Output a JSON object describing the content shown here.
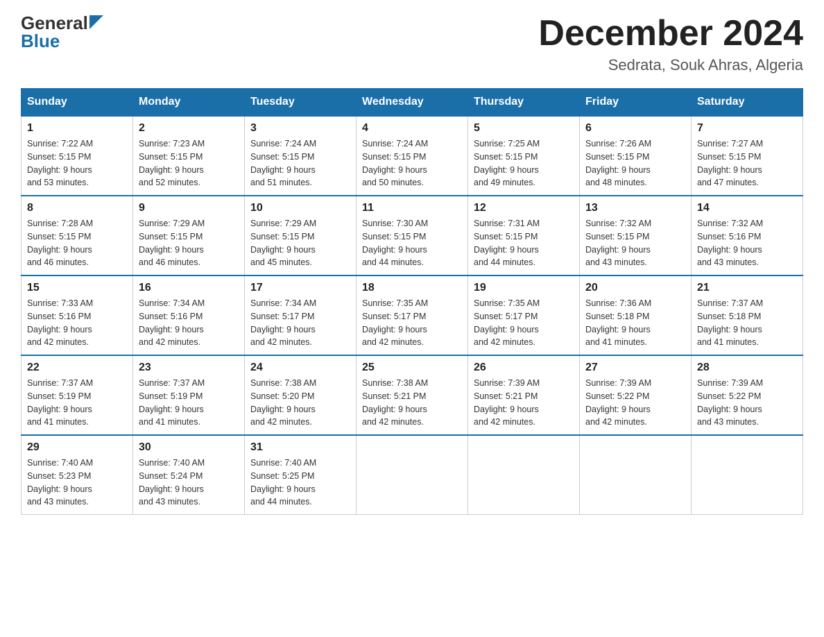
{
  "header": {
    "logo_general": "General",
    "logo_blue": "Blue",
    "month_title": "December 2024",
    "location": "Sedrata, Souk Ahras, Algeria"
  },
  "weekdays": [
    "Sunday",
    "Monday",
    "Tuesday",
    "Wednesday",
    "Thursday",
    "Friday",
    "Saturday"
  ],
  "weeks": [
    [
      {
        "day": "1",
        "sunrise": "7:22 AM",
        "sunset": "5:15 PM",
        "daylight": "9 hours and 53 minutes."
      },
      {
        "day": "2",
        "sunrise": "7:23 AM",
        "sunset": "5:15 PM",
        "daylight": "9 hours and 52 minutes."
      },
      {
        "day": "3",
        "sunrise": "7:24 AM",
        "sunset": "5:15 PM",
        "daylight": "9 hours and 51 minutes."
      },
      {
        "day": "4",
        "sunrise": "7:24 AM",
        "sunset": "5:15 PM",
        "daylight": "9 hours and 50 minutes."
      },
      {
        "day": "5",
        "sunrise": "7:25 AM",
        "sunset": "5:15 PM",
        "daylight": "9 hours and 49 minutes."
      },
      {
        "day": "6",
        "sunrise": "7:26 AM",
        "sunset": "5:15 PM",
        "daylight": "9 hours and 48 minutes."
      },
      {
        "day": "7",
        "sunrise": "7:27 AM",
        "sunset": "5:15 PM",
        "daylight": "9 hours and 47 minutes."
      }
    ],
    [
      {
        "day": "8",
        "sunrise": "7:28 AM",
        "sunset": "5:15 PM",
        "daylight": "9 hours and 46 minutes."
      },
      {
        "day": "9",
        "sunrise": "7:29 AM",
        "sunset": "5:15 PM",
        "daylight": "9 hours and 46 minutes."
      },
      {
        "day": "10",
        "sunrise": "7:29 AM",
        "sunset": "5:15 PM",
        "daylight": "9 hours and 45 minutes."
      },
      {
        "day": "11",
        "sunrise": "7:30 AM",
        "sunset": "5:15 PM",
        "daylight": "9 hours and 44 minutes."
      },
      {
        "day": "12",
        "sunrise": "7:31 AM",
        "sunset": "5:15 PM",
        "daylight": "9 hours and 44 minutes."
      },
      {
        "day": "13",
        "sunrise": "7:32 AM",
        "sunset": "5:15 PM",
        "daylight": "9 hours and 43 minutes."
      },
      {
        "day": "14",
        "sunrise": "7:32 AM",
        "sunset": "5:16 PM",
        "daylight": "9 hours and 43 minutes."
      }
    ],
    [
      {
        "day": "15",
        "sunrise": "7:33 AM",
        "sunset": "5:16 PM",
        "daylight": "9 hours and 42 minutes."
      },
      {
        "day": "16",
        "sunrise": "7:34 AM",
        "sunset": "5:16 PM",
        "daylight": "9 hours and 42 minutes."
      },
      {
        "day": "17",
        "sunrise": "7:34 AM",
        "sunset": "5:17 PM",
        "daylight": "9 hours and 42 minutes."
      },
      {
        "day": "18",
        "sunrise": "7:35 AM",
        "sunset": "5:17 PM",
        "daylight": "9 hours and 42 minutes."
      },
      {
        "day": "19",
        "sunrise": "7:35 AM",
        "sunset": "5:17 PM",
        "daylight": "9 hours and 42 minutes."
      },
      {
        "day": "20",
        "sunrise": "7:36 AM",
        "sunset": "5:18 PM",
        "daylight": "9 hours and 41 minutes."
      },
      {
        "day": "21",
        "sunrise": "7:37 AM",
        "sunset": "5:18 PM",
        "daylight": "9 hours and 41 minutes."
      }
    ],
    [
      {
        "day": "22",
        "sunrise": "7:37 AM",
        "sunset": "5:19 PM",
        "daylight": "9 hours and 41 minutes."
      },
      {
        "day": "23",
        "sunrise": "7:37 AM",
        "sunset": "5:19 PM",
        "daylight": "9 hours and 41 minutes."
      },
      {
        "day": "24",
        "sunrise": "7:38 AM",
        "sunset": "5:20 PM",
        "daylight": "9 hours and 42 minutes."
      },
      {
        "day": "25",
        "sunrise": "7:38 AM",
        "sunset": "5:21 PM",
        "daylight": "9 hours and 42 minutes."
      },
      {
        "day": "26",
        "sunrise": "7:39 AM",
        "sunset": "5:21 PM",
        "daylight": "9 hours and 42 minutes."
      },
      {
        "day": "27",
        "sunrise": "7:39 AM",
        "sunset": "5:22 PM",
        "daylight": "9 hours and 42 minutes."
      },
      {
        "day": "28",
        "sunrise": "7:39 AM",
        "sunset": "5:22 PM",
        "daylight": "9 hours and 43 minutes."
      }
    ],
    [
      {
        "day": "29",
        "sunrise": "7:40 AM",
        "sunset": "5:23 PM",
        "daylight": "9 hours and 43 minutes."
      },
      {
        "day": "30",
        "sunrise": "7:40 AM",
        "sunset": "5:24 PM",
        "daylight": "9 hours and 43 minutes."
      },
      {
        "day": "31",
        "sunrise": "7:40 AM",
        "sunset": "5:25 PM",
        "daylight": "9 hours and 44 minutes."
      },
      null,
      null,
      null,
      null
    ]
  ],
  "labels": {
    "sunrise": "Sunrise:",
    "sunset": "Sunset:",
    "daylight": "Daylight:"
  }
}
